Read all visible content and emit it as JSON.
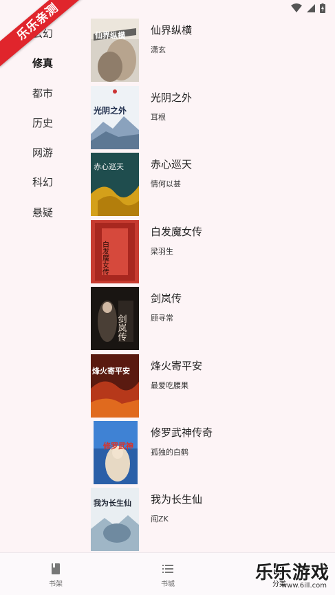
{
  "watermark": {
    "ribbon_text": "乐乐亲测",
    "corner_text": "乐乐游戏",
    "corner_url": "www.6ill.com"
  },
  "status_bar": {
    "icons": [
      "wifi-icon",
      "signal-icon",
      "battery-icon"
    ]
  },
  "sidebar": {
    "items": [
      {
        "label": "玄幻",
        "active": false
      },
      {
        "label": "修真",
        "active": true
      },
      {
        "label": "都市",
        "active": false
      },
      {
        "label": "历史",
        "active": false
      },
      {
        "label": "网游",
        "active": false
      },
      {
        "label": "科幻",
        "active": false
      },
      {
        "label": "悬疑",
        "active": false
      }
    ]
  },
  "books": [
    {
      "title": "仙界纵横",
      "author": "潇玄",
      "cover_text": "仙界纵横"
    },
    {
      "title": "光阴之外",
      "author": "耳根",
      "cover_text": "光阴之外"
    },
    {
      "title": "赤心巡天",
      "author": "情何以甚",
      "cover_text": "赤心巡天"
    },
    {
      "title": "白发魔女传",
      "author": "梁羽生",
      "cover_text": "白发魔女传"
    },
    {
      "title": "剑岚传",
      "author": "顾寻常",
      "cover_text": "剑岚传"
    },
    {
      "title": "烽火寄平安",
      "author": "最爱吃腰果",
      "cover_text": "烽火寄平安"
    },
    {
      "title": "修罗武神传奇",
      "author": "孤独的白鹤",
      "cover_text": "修罗武神"
    },
    {
      "title": "我为长生仙",
      "author": "阎ZK",
      "cover_text": "我为长生仙"
    }
  ],
  "bottom_nav": {
    "items": [
      {
        "label": "书架",
        "icon": "book-icon"
      },
      {
        "label": "书城",
        "icon": "list-icon"
      },
      {
        "label": "分类",
        "icon": "category-icon"
      }
    ]
  }
}
